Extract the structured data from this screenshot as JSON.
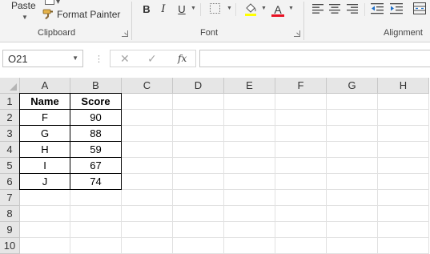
{
  "ribbon": {
    "clipboard": {
      "paste_label": "Paste",
      "format_painter_label": "Format Painter",
      "group_label": "Clipboard"
    },
    "font": {
      "bold": "B",
      "italic": "I",
      "underline": "U",
      "font_color": "A",
      "font_color_bar": "#e81123",
      "group_label": "Font"
    },
    "alignment": {
      "group_label": "Alignment"
    }
  },
  "formula_bar": {
    "name_box": "O21",
    "fx": "fx",
    "formula": ""
  },
  "sheet": {
    "columns": [
      "A",
      "B",
      "C",
      "D",
      "E",
      "F",
      "G",
      "H"
    ],
    "rows": [
      "1",
      "2",
      "3",
      "4",
      "5",
      "6",
      "7",
      "8",
      "9",
      "10"
    ],
    "header": {
      "name": "Name",
      "score": "Score"
    },
    "data": [
      {
        "name": "F",
        "score": "90"
      },
      {
        "name": "G",
        "score": "88"
      },
      {
        "name": "H",
        "score": "59"
      },
      {
        "name": "I",
        "score": "67"
      },
      {
        "name": "J",
        "score": "74"
      }
    ]
  }
}
